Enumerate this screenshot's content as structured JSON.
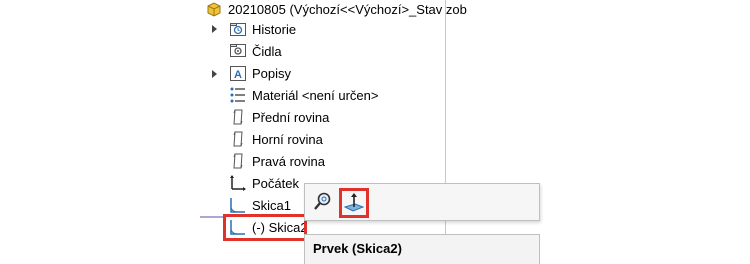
{
  "tree": {
    "root": {
      "label": "20210805  (Výchozí<<Výchozí>_Stav zob",
      "icon": "part-icon"
    },
    "items": [
      {
        "label": "Historie",
        "icon": "history-folder-icon",
        "expandable": true
      },
      {
        "label": "Čidla",
        "icon": "sensors-folder-icon",
        "expandable": false
      },
      {
        "label": "Popisy",
        "icon": "annotations-icon",
        "expandable": true
      },
      {
        "label": "Materiál <není určen>",
        "icon": "material-icon",
        "expandable": false
      },
      {
        "label": "Přední rovina",
        "icon": "plane-icon",
        "expandable": false
      },
      {
        "label": "Horní rovina",
        "icon": "plane-icon",
        "expandable": false
      },
      {
        "label": "Pravá rovina",
        "icon": "plane-icon",
        "expandable": false
      },
      {
        "label": "Počátek",
        "icon": "origin-icon",
        "expandable": false
      },
      {
        "label": "Skica1",
        "icon": "sketch-icon",
        "expandable": false
      },
      {
        "label": "(-) Skica2",
        "icon": "sketch-icon",
        "expandable": false,
        "selected": true
      }
    ]
  },
  "context_toolbar": {
    "buttons": [
      {
        "icon": "zoom-to-selection-icon"
      },
      {
        "icon": "normal-to-icon",
        "highlighted": true
      }
    ]
  },
  "context_menu": {
    "title": "Prvek (Skica2)"
  },
  "colors": {
    "highlight": "#e0312b",
    "icon_blue": "#2a6fb5"
  }
}
